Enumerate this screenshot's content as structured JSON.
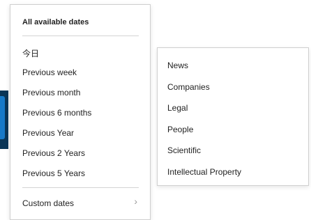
{
  "date_menu": {
    "header": "All available dates",
    "items": [
      "今日",
      "Previous week",
      "Previous month",
      "Previous 6 months",
      "Previous Year",
      "Previous 2 Years",
      "Previous 5 Years"
    ],
    "custom_label": "Custom dates",
    "custom_chevron_icon": "chevron-right-icon"
  },
  "category_menu": {
    "items": [
      "News",
      "Companies",
      "Legal",
      "People",
      "Scientific",
      "Intellectual Property"
    ]
  }
}
